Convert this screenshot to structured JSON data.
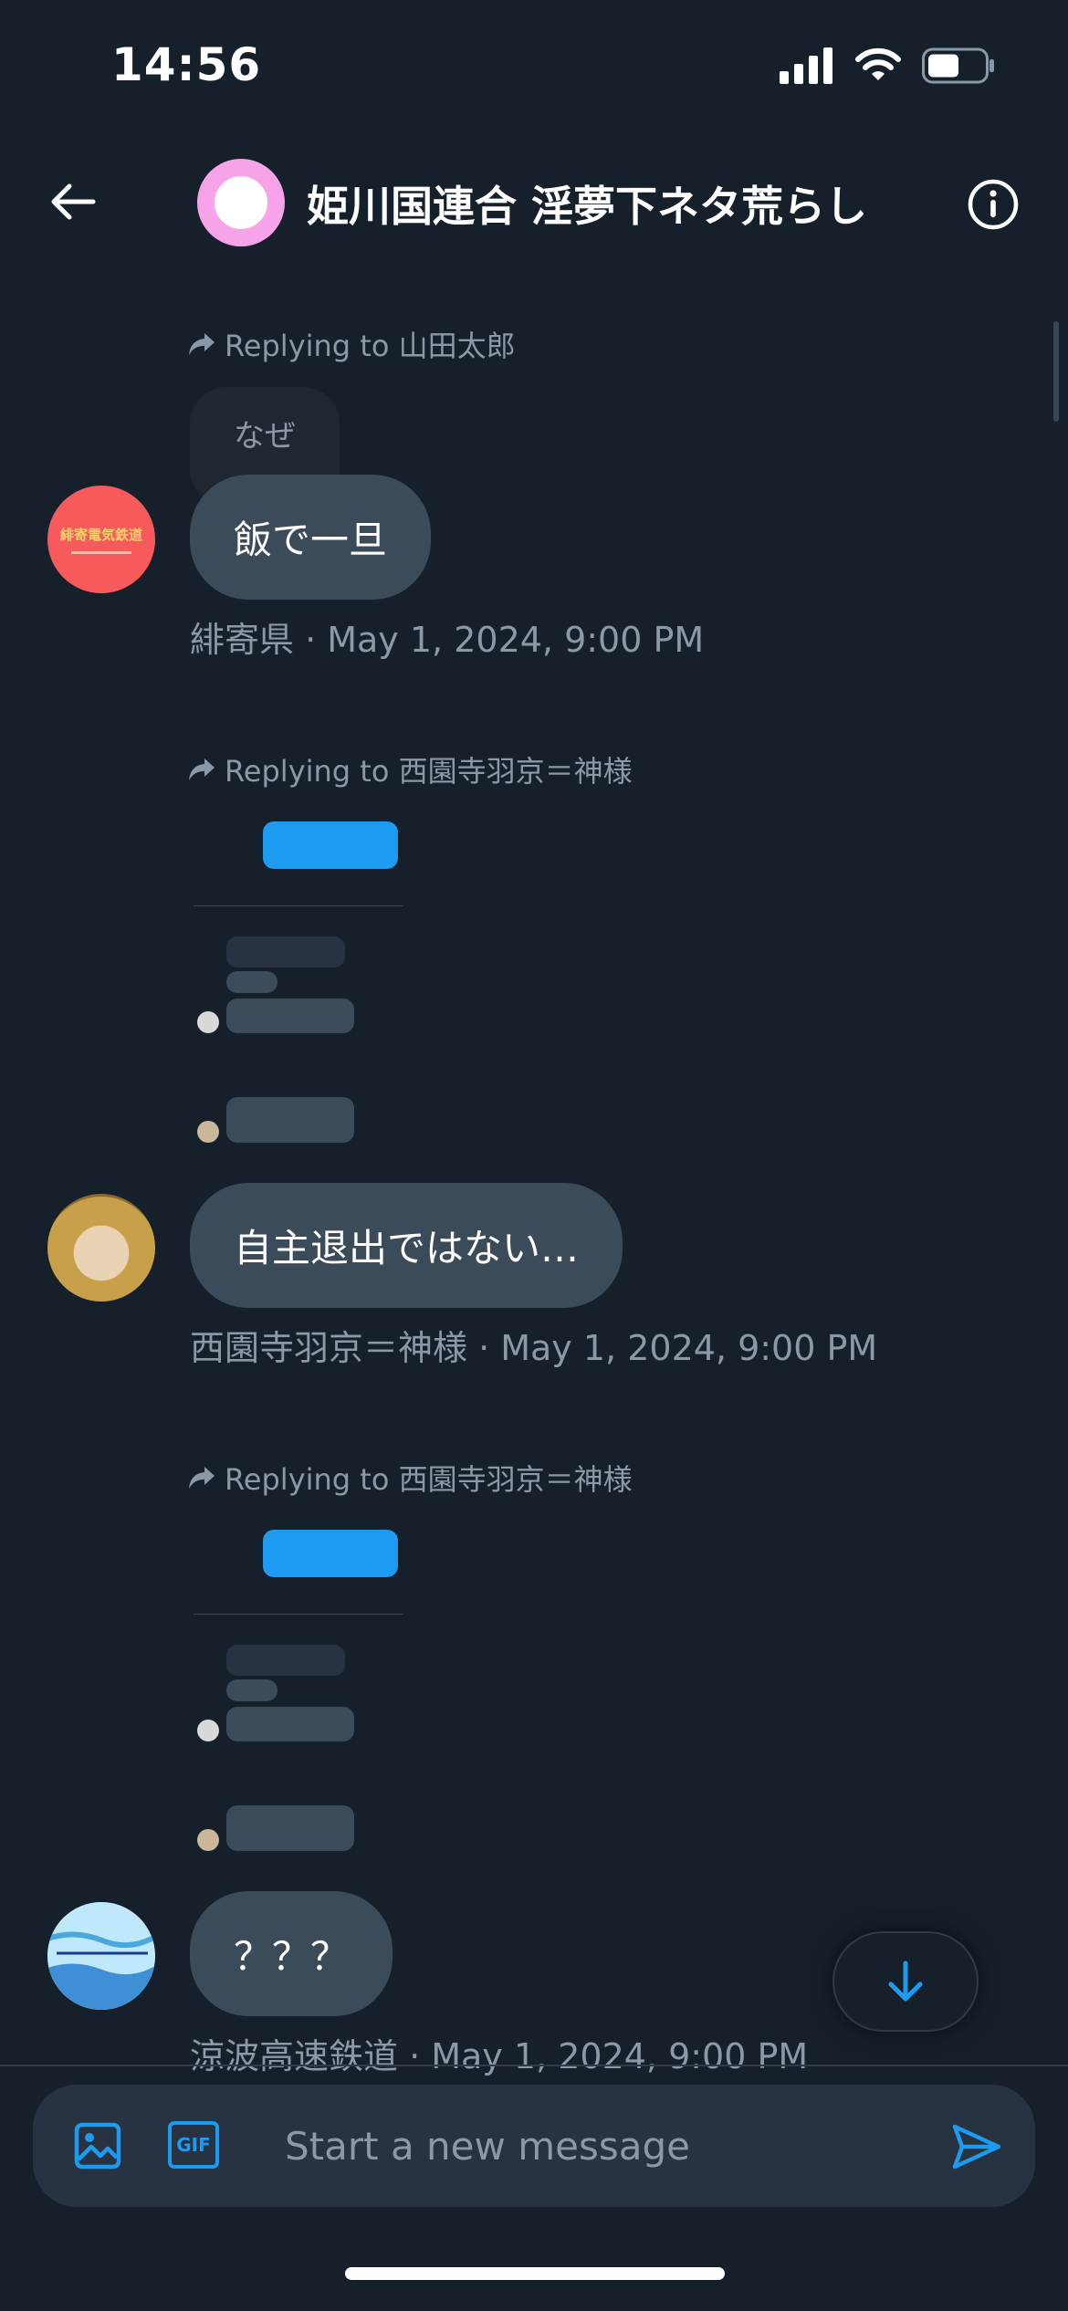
{
  "status_bar": {
    "time": "14:56",
    "icons": [
      "signal-icon",
      "wifi-icon",
      "battery-icon"
    ],
    "battery_level": 0.55
  },
  "header": {
    "back_icon": "arrow-left-icon",
    "title": "姫川国連合 淫夢下ネタ荒らし",
    "info_icon": "info-icon",
    "avatar_color": "#f7a3ea"
  },
  "messages": [
    {
      "reply_label": "Replying to 山田太郎",
      "quoted_text": "なぜ",
      "text": "飯で一旦",
      "sender": "緋寄県",
      "timestamp": "May 1, 2024, 9:00 PM",
      "meta": "緋寄県 · May 1, 2024, 9:00 PM",
      "avatar_color": "#f75a5a",
      "avatar_text": "緋寄電気鉄道"
    },
    {
      "reply_label": "Replying to 西園寺羽京＝神様",
      "text": "自主退出ではない…",
      "sender": "西園寺羽京＝神様",
      "timestamp": "May 1, 2024, 9:00 PM",
      "meta": "西園寺羽京＝神様 · May 1, 2024, 9:00 PM",
      "avatar_color": "#c9a04a"
    },
    {
      "reply_label": "Replying to 西園寺羽京＝神様",
      "text": "？？？",
      "sender": "涼波高速鉄道",
      "timestamp": "May 1, 2024, 9:00 PM",
      "meta": "涼波高速鉄道 · May 1, 2024, 9:00 PM",
      "avatar_color": "#7ecbf0"
    }
  ],
  "scroll_down_icon": "arrow-down-icon",
  "composer": {
    "placeholder": "Start a new message",
    "image_icon": "image-icon",
    "gif_icon": "gif-icon",
    "gif_label": "GIF",
    "send_icon": "send-icon"
  },
  "colors": {
    "background": "#15202b",
    "bubble": "#3b4b5a",
    "accent": "#1d9bf0",
    "muted_text": "#8b98a5"
  }
}
